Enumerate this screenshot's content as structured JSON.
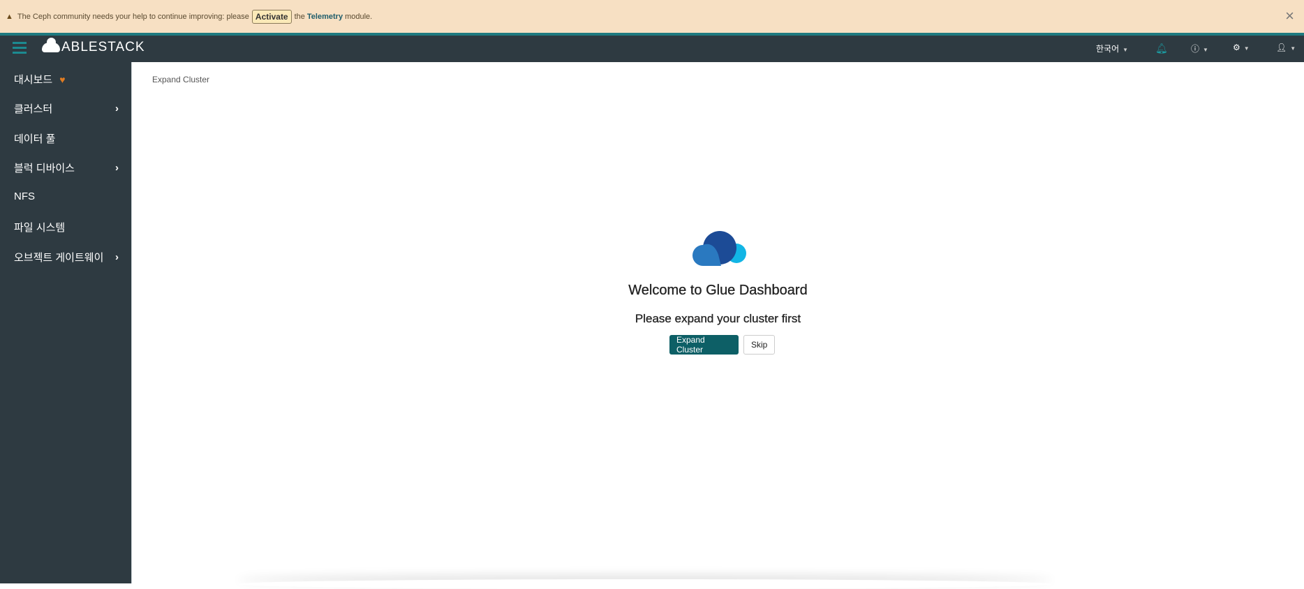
{
  "banner": {
    "text_before": "The Ceph community needs your help to continue improving: please",
    "activate_label": "Activate",
    "text_mid": "the",
    "telemetry_label": "Telemetry",
    "text_after": "module.",
    "close_label": "×"
  },
  "navbar": {
    "brand": "ABLESTACK",
    "language": "한국어"
  },
  "sidebar": {
    "items": [
      {
        "label": "대시보드"
      },
      {
        "label": "클러스터"
      },
      {
        "label": "데이터 풀"
      },
      {
        "label": "블럭 디바이스"
      },
      {
        "label": "NFS"
      },
      {
        "label": "파일 시스템"
      },
      {
        "label": "오브젝트 게이트웨이"
      }
    ]
  },
  "main": {
    "breadcrumb": "Expand Cluster",
    "title": "Welcome to Glue Dashboard",
    "subtitle": "Please expand your cluster first",
    "expand_label": "Expand Cluster",
    "skip_label": "Skip"
  },
  "colors": {
    "accent": "#0d5f66",
    "navbar": "#2e3a41",
    "banner": "#f7e0c3"
  }
}
